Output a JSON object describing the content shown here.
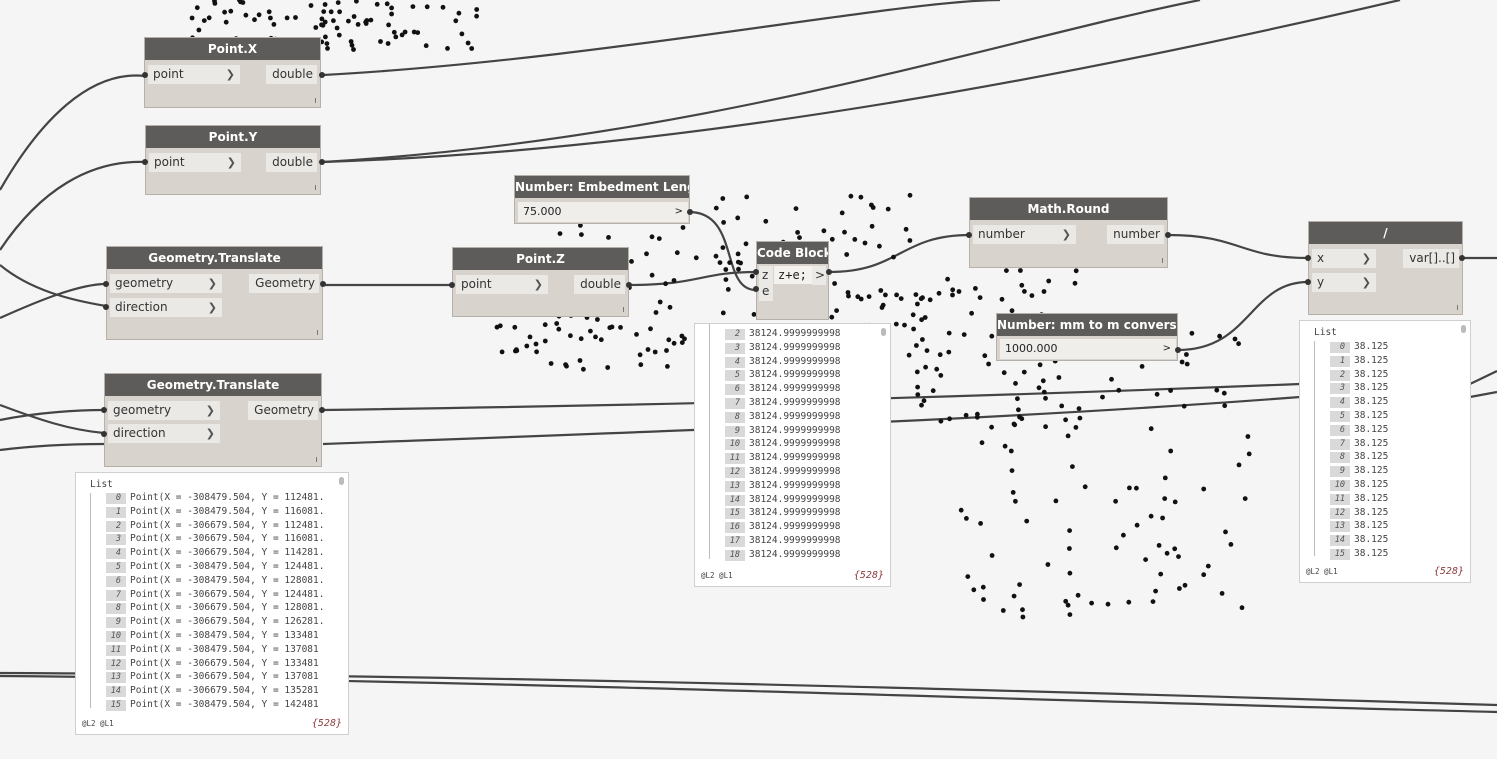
{
  "nodes": {
    "point_x": {
      "title": "Point.X",
      "input": "point",
      "output": "double"
    },
    "point_y": {
      "title": "Point.Y",
      "input": "point",
      "output": "double"
    },
    "translate_1": {
      "title": "Geometry.Translate",
      "inputs": [
        "geometry",
        "direction"
      ],
      "output": "Geometry"
    },
    "translate_2": {
      "title": "Geometry.Translate",
      "inputs": [
        "geometry",
        "direction"
      ],
      "output": "Geometry"
    },
    "point_z": {
      "title": "Point.Z",
      "input": "point",
      "output": "double"
    },
    "embedment": {
      "title": "Number: Embedment Length",
      "value": "75.000",
      "arrow": ">"
    },
    "code_block": {
      "title": "Code Block",
      "inputs": [
        "z",
        "e"
      ],
      "code": "z+e;",
      "arrow": ">"
    },
    "math_round": {
      "title": "Math.Round",
      "input": "number",
      "output": "number"
    },
    "conversion": {
      "title": "Number: mm to m conversion",
      "value": "1000.000",
      "arrow": ">"
    },
    "divide": {
      "title": "/",
      "inputs": [
        "x",
        "y"
      ],
      "output": "var[]..[]"
    }
  },
  "watch_translate": {
    "label": "List",
    "rows": [
      {
        "i": "0",
        "v": "Point(X = -308479.504, Y = 112481."
      },
      {
        "i": "1",
        "v": "Point(X = -308479.504, Y = 116081."
      },
      {
        "i": "2",
        "v": "Point(X = -306679.504, Y = 112481."
      },
      {
        "i": "3",
        "v": "Point(X = -306679.504, Y = 116081."
      },
      {
        "i": "4",
        "v": "Point(X = -306679.504, Y = 114281."
      },
      {
        "i": "5",
        "v": "Point(X = -308479.504, Y = 124481."
      },
      {
        "i": "6",
        "v": "Point(X = -308479.504, Y = 128081."
      },
      {
        "i": "7",
        "v": "Point(X = -306679.504, Y = 124481."
      },
      {
        "i": "8",
        "v": "Point(X = -306679.504, Y = 128081."
      },
      {
        "i": "9",
        "v": "Point(X = -306679.504, Y = 126281."
      },
      {
        "i": "10",
        "v": "Point(X = -308479.504, Y = 133481"
      },
      {
        "i": "11",
        "v": "Point(X = -308479.504, Y = 137081"
      },
      {
        "i": "12",
        "v": "Point(X = -306679.504, Y = 133481"
      },
      {
        "i": "13",
        "v": "Point(X = -306679.504, Y = 137081"
      },
      {
        "i": "14",
        "v": "Point(X = -306679.504, Y = 135281"
      },
      {
        "i": "15",
        "v": "Point(X = -308479.504, Y = 142481"
      }
    ],
    "levels": "@L2 @L1",
    "count": "{528}"
  },
  "watch_code": {
    "rows": [
      {
        "i": "2",
        "v": "38124.9999999998"
      },
      {
        "i": "3",
        "v": "38124.9999999998"
      },
      {
        "i": "4",
        "v": "38124.9999999998"
      },
      {
        "i": "5",
        "v": "38124.9999999998"
      },
      {
        "i": "6",
        "v": "38124.9999999998"
      },
      {
        "i": "7",
        "v": "38124.9999999998"
      },
      {
        "i": "8",
        "v": "38124.9999999998"
      },
      {
        "i": "9",
        "v": "38124.9999999998"
      },
      {
        "i": "10",
        "v": "38124.9999999998"
      },
      {
        "i": "11",
        "v": "38124.9999999998"
      },
      {
        "i": "12",
        "v": "38124.9999999998"
      },
      {
        "i": "13",
        "v": "38124.9999999998"
      },
      {
        "i": "14",
        "v": "38124.9999999998"
      },
      {
        "i": "15",
        "v": "38124.9999999998"
      },
      {
        "i": "16",
        "v": "38124.9999999998"
      },
      {
        "i": "17",
        "v": "38124.9999999998"
      },
      {
        "i": "18",
        "v": "38124.9999999998"
      }
    ],
    "levels": "@L2 @L1",
    "count": "{528}"
  },
  "watch_divide": {
    "label": "List",
    "rows": [
      {
        "i": "0",
        "v": "38.125"
      },
      {
        "i": "1",
        "v": "38.125"
      },
      {
        "i": "2",
        "v": "38.125"
      },
      {
        "i": "3",
        "v": "38.125"
      },
      {
        "i": "4",
        "v": "38.125"
      },
      {
        "i": "5",
        "v": "38.125"
      },
      {
        "i": "6",
        "v": "38.125"
      },
      {
        "i": "7",
        "v": "38.125"
      },
      {
        "i": "8",
        "v": "38.125"
      },
      {
        "i": "9",
        "v": "38.125"
      },
      {
        "i": "10",
        "v": "38.125"
      },
      {
        "i": "11",
        "v": "38.125"
      },
      {
        "i": "12",
        "v": "38.125"
      },
      {
        "i": "13",
        "v": "38.125"
      },
      {
        "i": "14",
        "v": "38.125"
      },
      {
        "i": "15",
        "v": "38.125"
      }
    ],
    "levels": "@L2 @L1",
    "count": "{528}"
  },
  "colors": {
    "canvas": "#f5f5f5",
    "node_header": "#5e5c5a",
    "node_body": "#d8d4cd",
    "wire": "#3d3d3d",
    "count": "#8a3a3a"
  }
}
